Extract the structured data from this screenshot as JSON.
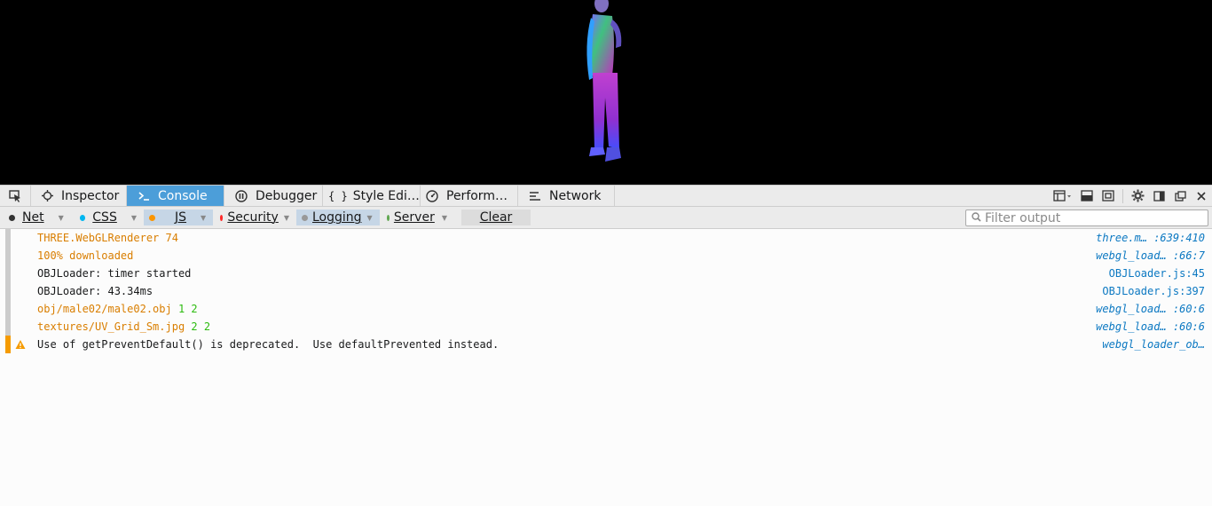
{
  "toolbar": {
    "tabs": [
      {
        "label": "Inspector",
        "icon": "inspector-icon"
      },
      {
        "label": "Console",
        "icon": "console-icon",
        "selected": true
      },
      {
        "label": "Debugger",
        "icon": "debugger-icon"
      },
      {
        "label": "Style Edi…",
        "icon": "style-editor-icon"
      },
      {
        "label": "Perform…",
        "icon": "performance-icon"
      },
      {
        "label": "Network",
        "icon": "network-icon"
      }
    ]
  },
  "filters": {
    "net": "Net",
    "css": "CSS",
    "js": "JS",
    "security": "Security",
    "logging": "Logging",
    "server": "Server",
    "clear": "Clear",
    "search_placeholder": "Filter output",
    "colors": {
      "net": "#333333",
      "css": "#00b6f0",
      "js": "#fb9500",
      "security": "#ff2a2a",
      "logging": "#999999",
      "server": "#5ea64e"
    }
  },
  "log": [
    {
      "msg": "THREE.WebGLRenderer 74",
      "extra": "",
      "loc": "three.m… :639:410",
      "color": "orange"
    },
    {
      "msg": "100% downloaded",
      "extra": "",
      "loc": "webgl_load… :66:7",
      "color": "orange"
    },
    {
      "msg": "OBJLoader: timer started",
      "extra": "",
      "loc": "OBJLoader.js:45",
      "color": "dark"
    },
    {
      "msg": "OBJLoader: 43.34ms",
      "extra": "",
      "loc": "OBJLoader.js:397",
      "color": "dark"
    },
    {
      "msg": "obj/male02/male02.obj",
      "extra": "1 2",
      "loc": "webgl_load… :60:6",
      "color": "orange"
    },
    {
      "msg": "textures/UV_Grid_Sm.jpg",
      "extra": "2 2",
      "loc": "webgl_load… :60:6",
      "color": "orange"
    },
    {
      "msg": "Use of getPreventDefault() is deprecated.  Use defaultPrevented instead.",
      "extra": "",
      "loc": "webgl_loader_ob…",
      "color": "dark",
      "warning": true
    }
  ]
}
